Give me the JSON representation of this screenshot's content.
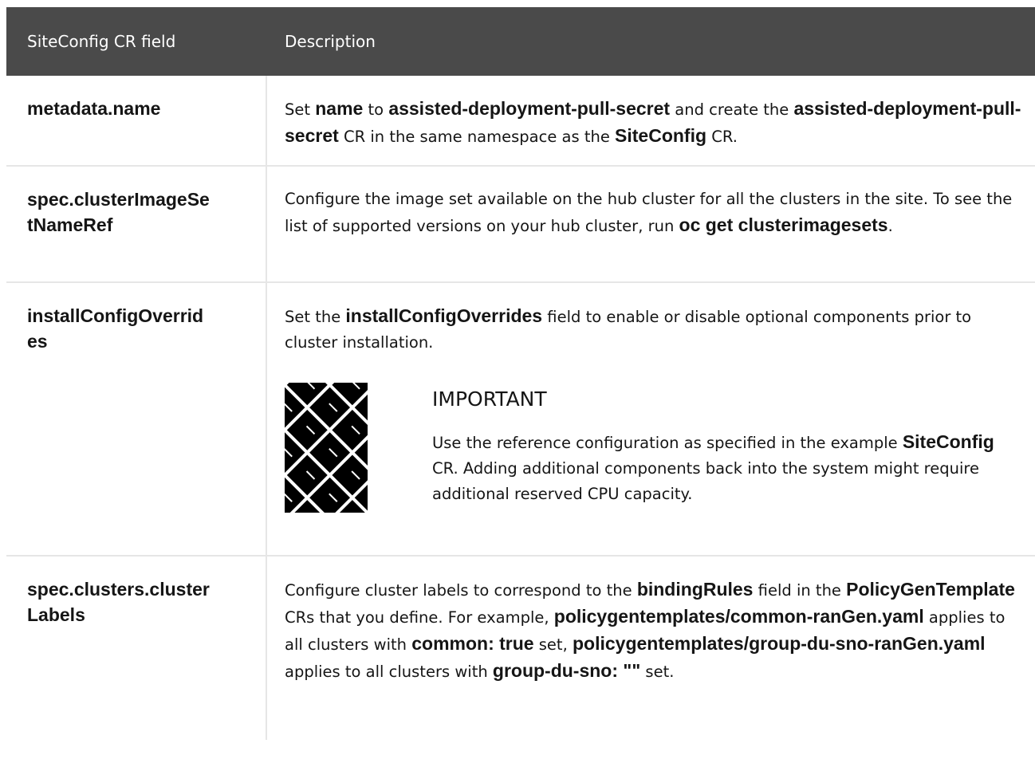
{
  "table": {
    "headers": {
      "field": "SiteConfig CR field",
      "description": "Description"
    },
    "rows": [
      {
        "field": "metadata.name",
        "desc": [
          {
            "t": "Set ",
            "b": false
          },
          {
            "t": "name",
            "b": true
          },
          {
            "t": " to ",
            "b": false
          },
          {
            "t": "assisted-deployment-pull-secret",
            "b": true
          },
          {
            "t": " and create the ",
            "b": false
          },
          {
            "t": "assisted-deployment-pull-secret",
            "b": true
          },
          {
            "t": " CR in the same namespace as the ",
            "b": false
          },
          {
            "t": "SiteConfig",
            "b": true
          },
          {
            "t": " CR.",
            "b": false
          }
        ]
      },
      {
        "field": "spec.clusterImageSetNameRef",
        "desc": [
          {
            "t": "Configure the image set available on the hub cluster for all the clusters in the site. To see the list of supported versions on your hub cluster, run ",
            "b": false
          },
          {
            "t": "oc get clusterimagesets",
            "b": true
          },
          {
            "t": ".",
            "b": false
          }
        ]
      },
      {
        "field": "installConfigOverrides",
        "desc": [
          {
            "t": "Set the ",
            "b": false
          },
          {
            "t": "installConfigOverrides",
            "b": true
          },
          {
            "t": " field to enable or disable optional components prior to cluster installation.",
            "b": false
          }
        ],
        "admonition": {
          "icon": "important-icon",
          "title": "IMPORTANT",
          "text": [
            {
              "t": "Use the reference configuration as specified in the example ",
              "b": false
            },
            {
              "t": "SiteConfig",
              "b": true
            },
            {
              "t": " CR. Adding additional components back into the system might require additional reserved CPU capacity.",
              "b": false
            }
          ]
        }
      },
      {
        "field": "spec.clusters.clusterLabels",
        "desc": [
          {
            "t": "Configure cluster labels to correspond to the ",
            "b": false
          },
          {
            "t": "bindingRules",
            "b": true
          },
          {
            "t": " field in the ",
            "b": false
          },
          {
            "t": "PolicyGenTemplate",
            "b": true
          },
          {
            "t": " CRs that you define. For example, ",
            "b": false
          },
          {
            "t": "policygentemplates/common-ranGen.yaml",
            "b": true
          },
          {
            "t": " applies to all clusters with ",
            "b": false
          },
          {
            "t": "common: true",
            "b": true
          },
          {
            "t": " set, ",
            "b": false
          },
          {
            "t": "policygentemplates/group-du-sno-ranGen.yaml",
            "b": true
          },
          {
            "t": " applies to all clusters with ",
            "b": false
          },
          {
            "t": "group-du-sno: \"\"",
            "b": true
          },
          {
            "t": " set.",
            "b": false
          }
        ]
      }
    ]
  }
}
